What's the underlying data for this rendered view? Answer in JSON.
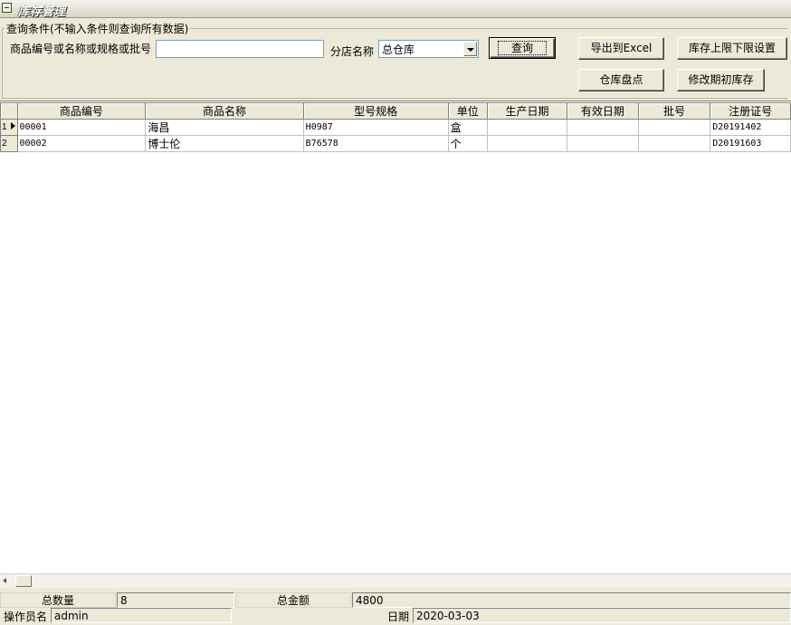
{
  "window": {
    "title": "库存管理"
  },
  "query": {
    "legend": "查询条件(不输入条件则查询所有数据)",
    "keyword_label": "商品编号或名称或规格或批号",
    "keyword_value": "",
    "branch_label": "分店名称",
    "branch_selected": "总仓库",
    "search_button": "查询",
    "export_button": "导出到Excel",
    "limit_button": "库存上限下限设置",
    "stocktake_button": "仓库盘点",
    "opening_button": "修改期初库存"
  },
  "grid": {
    "columns": [
      "商品编号",
      "商品名称",
      "型号规格",
      "单位",
      "生产日期",
      "有效日期",
      "批号",
      "注册证号"
    ],
    "rows": [
      {
        "num": "1",
        "cells": [
          "00001",
          "海昌",
          "H0987",
          "盒",
          "",
          "",
          "",
          "D20191402"
        ]
      },
      {
        "num": "2",
        "cells": [
          "00002",
          "博士伦",
          "B76578",
          "个",
          "",
          "",
          "",
          "D20191603"
        ]
      }
    ]
  },
  "summary": {
    "total_qty_label": "总数量",
    "total_qty_value": "8",
    "total_amount_label": "总金额",
    "total_amount_value": "4800",
    "operator_label": "操作员名",
    "operator_value": "admin",
    "date_label": "日期",
    "date_value": "2020-03-03"
  }
}
